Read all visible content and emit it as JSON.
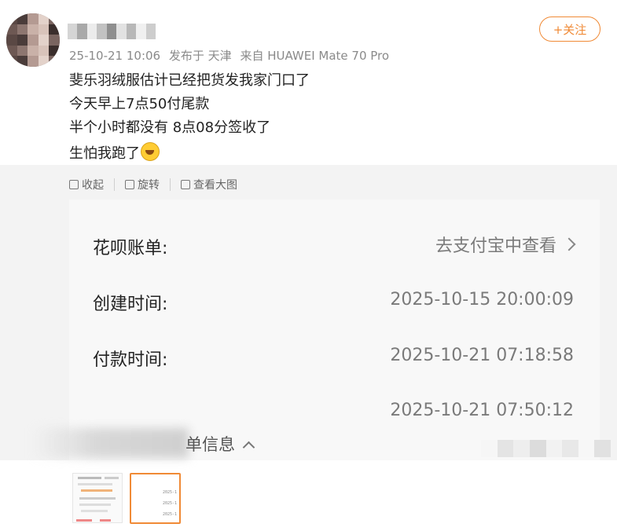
{
  "header": {
    "meta": {
      "time": "25-10-21 10:06",
      "location": "发布于 天津",
      "device": "来自 HUAWEI Mate 70 Pro"
    },
    "follow_label": "+关注"
  },
  "post": {
    "lines": [
      "斐乐羽绒服估计已经把货发我家门口了",
      "今天早上7点50付尾款",
      "半个小时都没有 8点08分签收了",
      "生怕我跑了"
    ],
    "emoji_icon": "crying-laughing-face-icon"
  },
  "toolbar": {
    "collapse_label": "收起",
    "rotate_label": "旋转",
    "view_large_label": "查看大图"
  },
  "receipt": {
    "rows": [
      {
        "label": "花呗账单:",
        "value": "去支付宝中查看"
      },
      {
        "label": "创建时间:",
        "value": "2025-10-15 20:00:09"
      },
      {
        "label": "付款时间:",
        "value": "2025-10-21 07:18:58"
      },
      {
        "label": "",
        "value": "2025-10-21 07:50:12"
      }
    ],
    "order_info_label": "单信息"
  },
  "thumbnails": {
    "thumb2_lines": [
      "2025-1",
      "2025-1",
      "2025-1"
    ]
  }
}
